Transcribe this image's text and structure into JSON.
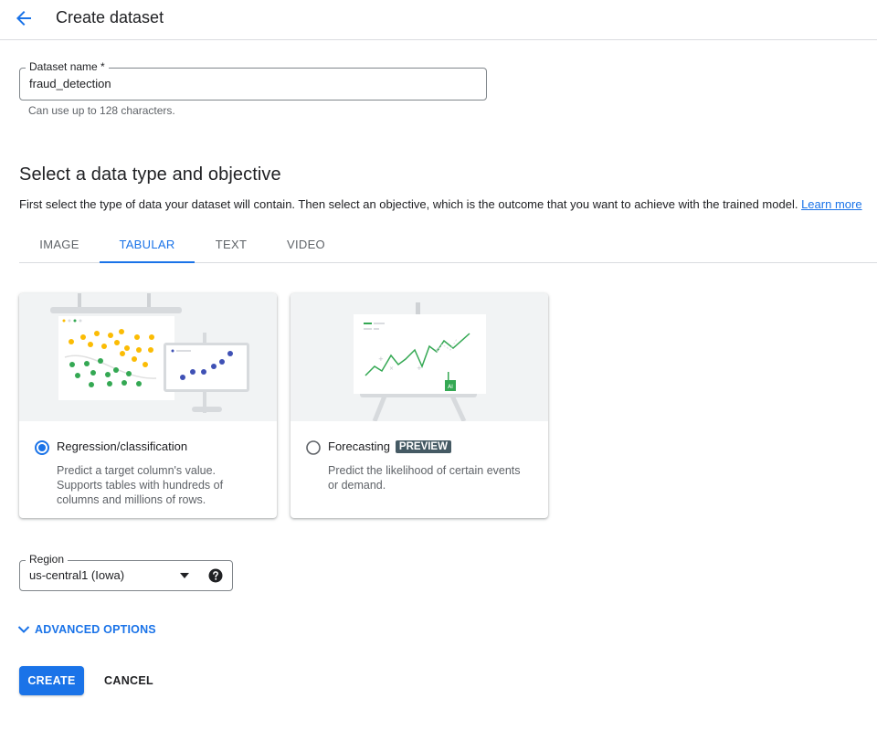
{
  "header": {
    "title": "Create dataset",
    "back_icon": "arrow-back-icon"
  },
  "dataset_name": {
    "label": "Dataset name *",
    "value": "fraud_detection",
    "hint": "Can use up to 128 characters."
  },
  "section": {
    "title": "Select a data type and objective",
    "description": "First select the type of data your dataset will contain. Then select an objective, which is the outcome that you want to achieve with the trained model.",
    "learn_more": "Learn more"
  },
  "tabs": [
    {
      "label": "IMAGE",
      "active": false
    },
    {
      "label": "TABULAR",
      "active": true
    },
    {
      "label": "TEXT",
      "active": false
    },
    {
      "label": "VIDEO",
      "active": false
    }
  ],
  "objectives": [
    {
      "title": "Regression/classification",
      "description": "Predict a target column's value. Supports tables with hundreds of columns and millions of rows.",
      "selected": true
    },
    {
      "title": "Forecasting",
      "badge": "PREVIEW",
      "description": "Predict the likelihood of certain events or demand.",
      "selected": false
    }
  ],
  "region": {
    "label": "Region",
    "value": "us-central1 (Iowa)",
    "dropdown_icon": "arrow-drop-down-icon",
    "help_icon": "help-icon"
  },
  "advanced_options": {
    "label": "ADVANCED OPTIONS",
    "icon": "chevron-down-icon"
  },
  "actions": {
    "create": "CREATE",
    "cancel": "CANCEL"
  },
  "colors": {
    "accent": "#1a73e8",
    "badge": "#455a64",
    "illustration_bg": "#f1f3f4",
    "dot_yellow": "#fbbc04",
    "dot_green": "#34a853",
    "dot_blue": "#3f51b5"
  }
}
